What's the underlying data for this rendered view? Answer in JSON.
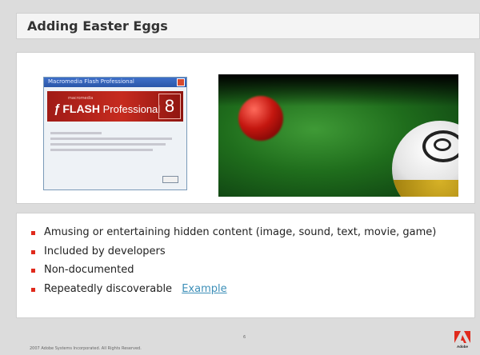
{
  "slide": {
    "title": "Adding Easter Eggs",
    "bullets": [
      "Amusing or entertaining hidden content (image, sound, text, movie, game)",
      "Included by developers",
      "Non-documented",
      "Repeatedly discoverable"
    ],
    "link_text": "Example",
    "footer_copyright": "2007 Adobe Systems Incorporated.  All Rights Reserved.",
    "page_number": "6",
    "logo_text": "Adobe",
    "colors": {
      "bullet": "#e02a1c",
      "link": "#3d8fb8",
      "adobe_red": "#e02a1c"
    }
  },
  "flash_dialog": {
    "title": "Macromedia Flash Professional",
    "brand": "FLASH",
    "product": "Professional",
    "version": "8",
    "small_label": "macromedia"
  },
  "icons": {
    "flash_f": "flash-f-icon",
    "adobe": "adobe-logo-icon"
  }
}
